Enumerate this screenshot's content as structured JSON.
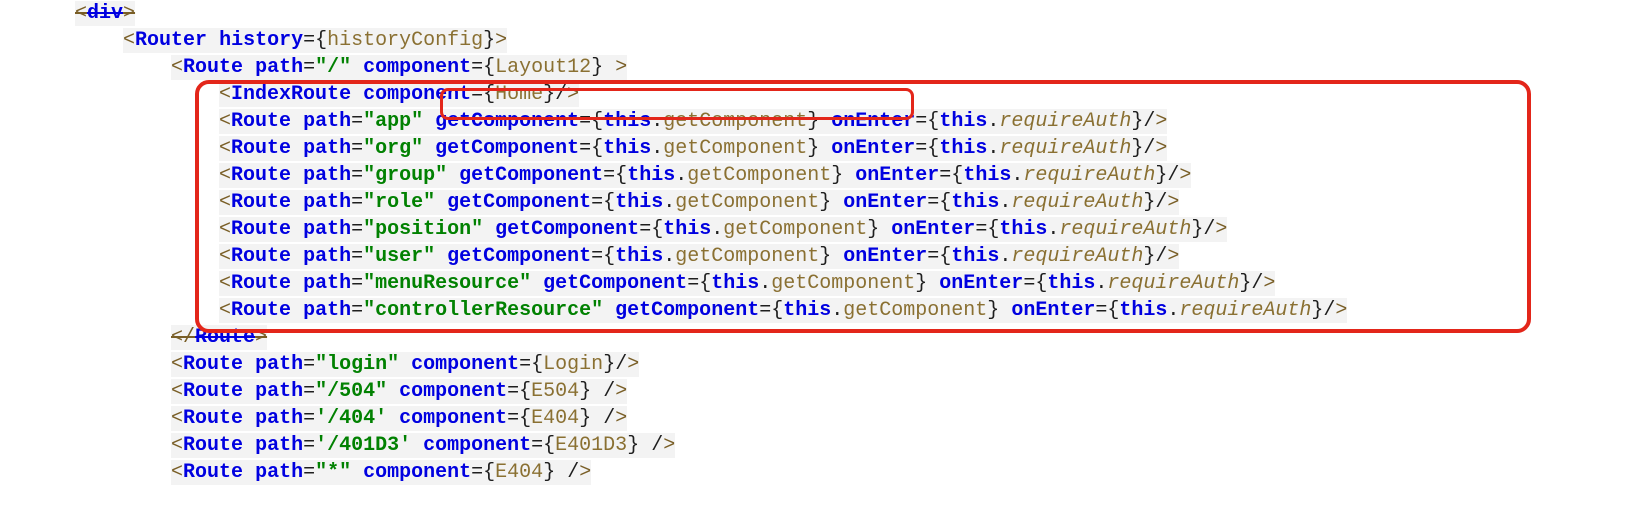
{
  "code": {
    "router_open": {
      "tag": "Router",
      "attr": "history",
      "var": "historyConfig"
    },
    "route_root": {
      "tag": "Route",
      "path_attr": "path",
      "path_val": "\"/\"",
      "comp_attr": "component",
      "comp_val": "Layout12"
    },
    "index_route": {
      "tag": "IndexRoute",
      "comp_attr": "component",
      "comp_val": "Home"
    },
    "routes": [
      {
        "path": "\"app\"",
        "get": "getComponent",
        "enter": "onEnter"
      },
      {
        "path": "\"org\"",
        "get": "getComponent",
        "enter": "onEnter"
      },
      {
        "path": "\"group\"",
        "get": "getComponent",
        "enter": "onEnter"
      },
      {
        "path": "\"role\"",
        "get": "getComponent",
        "enter": "onEnter"
      },
      {
        "path": "\"position\"",
        "get": "getComponent",
        "enter": "onEnter"
      },
      {
        "path": "\"user\"",
        "get": "getComponent",
        "enter": "onEnter"
      },
      {
        "path": "\"menuResource\"",
        "get": "getComponent",
        "enter": "onEnter"
      },
      {
        "path": "\"controllerResource\"",
        "get": "getComponent",
        "enter": "onEnter"
      }
    ],
    "this_kw": "this",
    "getComp_m": "getComponent",
    "requireAuth_m": "requireAuth",
    "route_close": "</Route>",
    "tail": [
      {
        "path": "\"login\"",
        "comp": "Login",
        "space": ""
      },
      {
        "path": "\"/504\"",
        "comp": "E504",
        "space": " "
      },
      {
        "path": "'/404'",
        "comp": "E404",
        "space": " "
      },
      {
        "path": "'/401D3'",
        "comp": "E401D3",
        "space": " "
      },
      {
        "path": "\"*\"",
        "comp": "E404",
        "space": " "
      }
    ],
    "tag_route": "Route",
    "attr_path": "path",
    "attr_comp": "component"
  }
}
